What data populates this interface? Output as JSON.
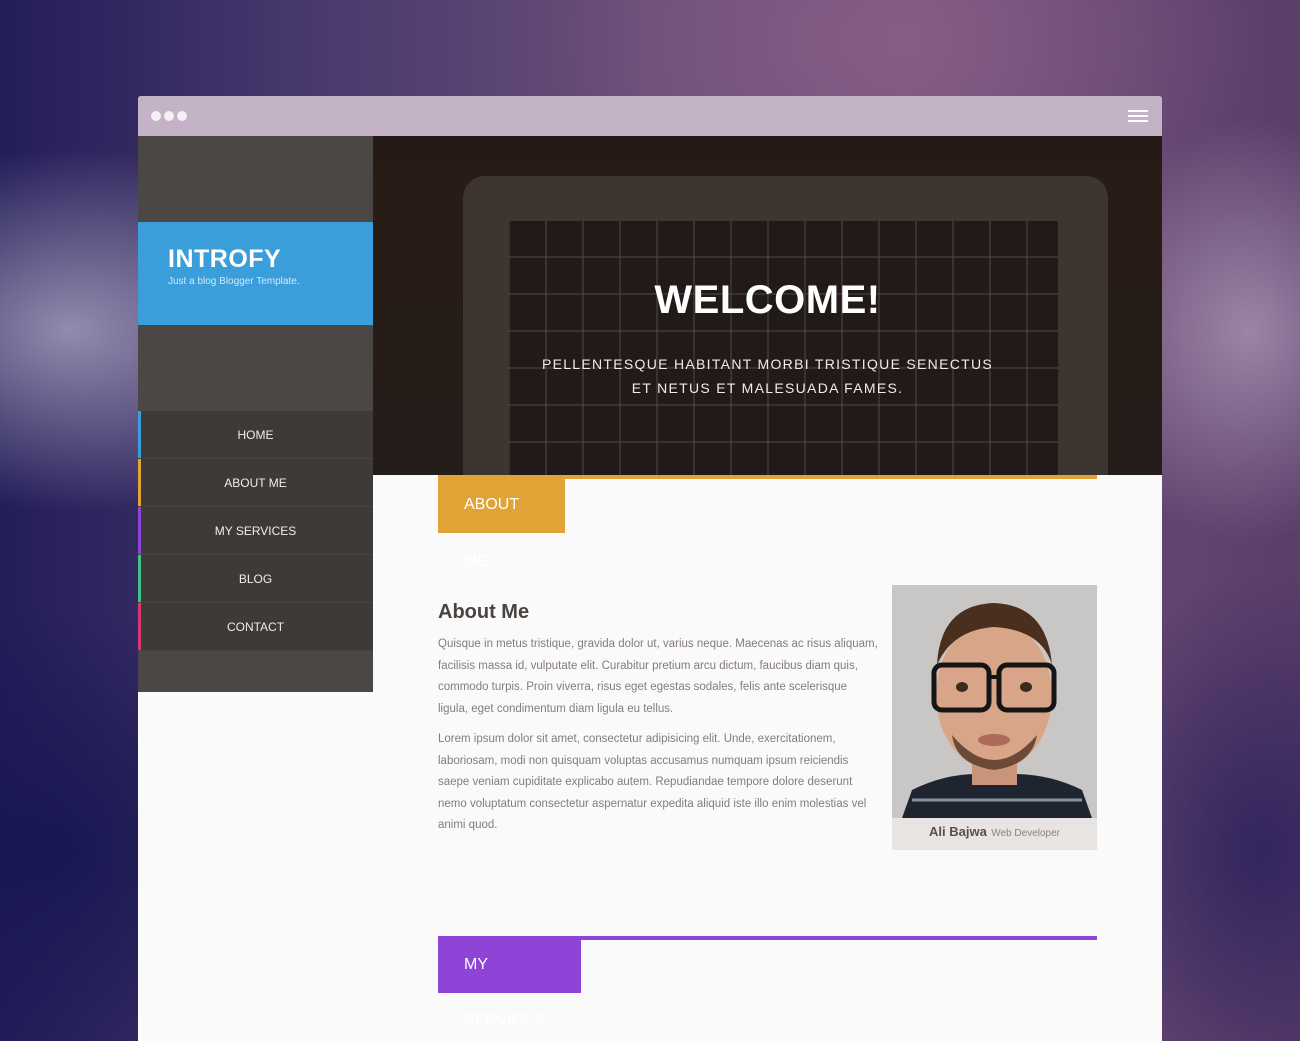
{
  "window": {
    "dots": [
      "dot-1",
      "dot-2",
      "dot-3"
    ],
    "menu_icon": "hamburger-menu-icon"
  },
  "brand": {
    "title": "INTROFY",
    "tagline": "Just a blog Blogger Template.",
    "color": "#3a9edb"
  },
  "nav": {
    "items": [
      {
        "label": "HOME",
        "accent": "#3a9edb"
      },
      {
        "label": "ABOUT ME",
        "accent": "#e2a336"
      },
      {
        "label": "MY SERVICES",
        "accent": "#8e44d6"
      },
      {
        "label": "BLOG",
        "accent": "#3ec28a"
      },
      {
        "label": "CONTACT",
        "accent": "#d6386e"
      }
    ]
  },
  "hero": {
    "title": "WELCOME!",
    "subtitle_line1": "PELLENTESQUE HABITANT MORBI TRISTIQUE SENECTUS",
    "subtitle_line2": "ET NETUS ET MALESUADA FAMES."
  },
  "about": {
    "tab_label": "ABOUT ME",
    "color": "#e2a336",
    "heading": "About Me",
    "paragraph1": "Quisque in metus tristique, gravida dolor ut, varius neque. Maecenas ac risus aliquam, facilisis massa id, vulputate elit. Curabitur pretium arcu dictum, faucibus diam quis, commodo turpis. Proin viverra, risus eget egestas sodales, felis ante scelerisque ligula, eget condimentum diam ligula eu tellus.",
    "paragraph2": "Lorem ipsum dolor sit amet, consectetur adipisicing elit. Unde, exercitationem, laboriosam, modi non quisquam voluptas accusamus numquam ipsum reiciendis saepe veniam cupiditate explicabo autem. Repudiandae tempore dolore deserunt nemo voluptatum consectetur aspernatur expedita aliquid iste illo enim molestias vel animi quod.",
    "profile": {
      "name": "Ali Bajwa",
      "role": "Web Developer"
    }
  },
  "services": {
    "tab_label": "MY SERVICES",
    "color": "#8e44d6"
  }
}
